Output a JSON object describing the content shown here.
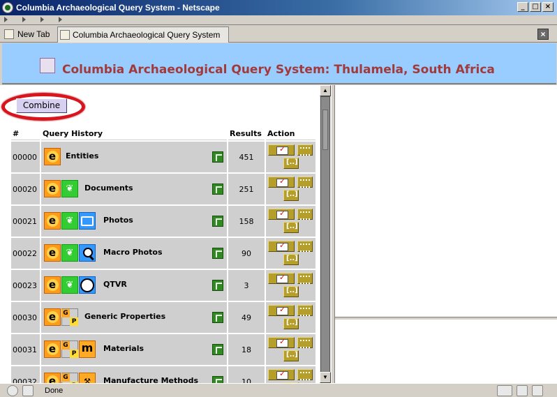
{
  "window": {
    "title": "Columbia Archaeological Query System - Netscape"
  },
  "tabs": {
    "new_tab": "New Tab",
    "active_tab": "Columbia Archaeological Query System"
  },
  "page": {
    "heading": "Columbia Archaeological Query System: Thulamela, South Africa"
  },
  "combine_button": "Combine",
  "table": {
    "headers": {
      "num": "#",
      "query": "Query History",
      "results": "Results",
      "action": "Action"
    },
    "rows": [
      {
        "id": "00000",
        "label": "Entities",
        "results": "451",
        "icons": [
          "entities-icon"
        ]
      },
      {
        "id": "00020",
        "label": "Documents",
        "results": "251",
        "icons": [
          "entities-icon",
          "documents-icon"
        ]
      },
      {
        "id": "00021",
        "label": "Photos",
        "results": "158",
        "icons": [
          "entities-icon",
          "documents-icon",
          "photo-icon"
        ]
      },
      {
        "id": "00022",
        "label": "Macro Photos",
        "results": "90",
        "icons": [
          "entities-icon",
          "documents-icon",
          "magnifier-icon"
        ]
      },
      {
        "id": "00023",
        "label": "QTVR",
        "results": "3",
        "icons": [
          "entities-icon",
          "documents-icon",
          "qtvr-icon"
        ]
      },
      {
        "id": "00030",
        "label": "Generic Properties",
        "results": "49",
        "icons": [
          "entities-icon",
          "generic-properties-icon"
        ]
      },
      {
        "id": "00031",
        "label": "Materials",
        "results": "18",
        "icons": [
          "entities-icon",
          "generic-properties-icon",
          "materials-icon"
        ]
      },
      {
        "id": "00032",
        "label": "Manufacture Methods",
        "results": "10",
        "icons": [
          "entities-icon",
          "generic-properties-icon",
          "hammer-icon"
        ]
      }
    ]
  },
  "statusbar": {
    "text": "Done"
  },
  "colors": {
    "banner": "#99ccff",
    "heading": "#a23a3a",
    "combine_highlight": "#d8141c",
    "row_bg": "#cfcfcf",
    "action_button": "#b59f2a"
  }
}
